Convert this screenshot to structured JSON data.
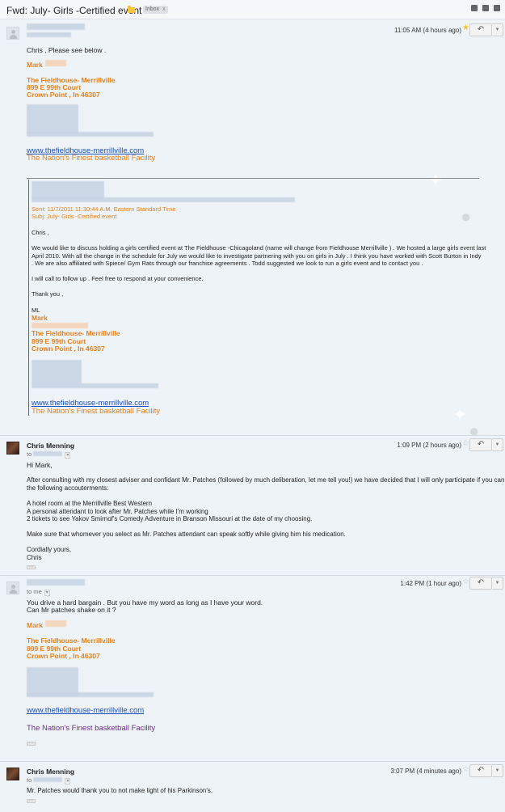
{
  "header": {
    "subject": "Fwd: July- Girls -Certified event",
    "label": "Inbox",
    "label_remove": "x",
    "icons": [
      "expand-icon",
      "print-icon",
      "popout-icon"
    ]
  },
  "messages": [
    {
      "sender": "",
      "time": "11:05 AM (4 hours ago)",
      "starred": true,
      "body": [
        "Chris , Please see below ."
      ],
      "signature": {
        "name": "Mark",
        "company": "The Fieldhouse- Merrillville",
        "address": "899 E 99th Court",
        "city": "Crown Point , In 46307",
        "link": "www.thefieldhouse-merrillville.com",
        "tagline": "The Nation's Finest basketball Facility"
      },
      "quoted": {
        "sent": "Sent: 11/7/2011 11:30:44 A.M. Eastern Standard Time",
        "subj": "Subj: July- Girls -Certified event",
        "greeting": "Chris ,",
        "p1": [
          "We would like to discuss holding a girls certified event at The Fieldhouse -Chicagoland (name will change from Fieldhouse Merrillville ) . We hosted a large girls event last",
          "April 2010. With all the change in the schedule for July we would like to investigate partnering with you on girls in July . I think you have worked with  Scott Burton in Indy",
          ". We are also affiliated with Spiece/ Gym Rats through our franchise agreements . Todd suggested we look to run a girls event and to contact you ."
        ],
        "p2": "I will call to follow up . Feel free to respond at your convenience.",
        "thanks": "Thank you ,",
        "initials": "ML",
        "name": "Mark",
        "company": "The Fieldhouse- Merrillville",
        "address": "899 E 99th Court",
        "city": "Crown Point , In 46307",
        "link": "www.thefieldhouse-merrillville.com",
        "tagline": "The Nation's Finest basketball Facility"
      }
    },
    {
      "sender": "Chris Menning",
      "to": "to",
      "time": "1:09 PM (2 hours ago)",
      "starred": false,
      "lines": [
        "Hi Mark,",
        "After consulting with my closest adviser and confidant Mr. Patches (followed by much deliberation, let me tell you!) we have decided that I will only participate if you can furnish",
        "the following accouterments:",
        "A hotel room at the Merrillville Best Western",
        "A personal attendant to look after Mr. Patches while I'm working",
        "2 tickets to see Yakov Smirnof's Comedy Adventure in Branson Missouri at the date of my choosing.",
        "Make sure that whomever you select as Mr. Patches attendant can speak softly while giving him his medication.",
        "Cordially yours,",
        "Chris"
      ]
    },
    {
      "sender": "",
      "to": "to me",
      "time": "1:42 PM (1 hour ago)",
      "starred": false,
      "lines": [
        "You drive a hard bargain . But you have my word as long as I have your word.",
        "Can Mr patches shake on it ?"
      ],
      "signature": {
        "name": "Mark",
        "company": "The Fieldhouse- Merrillville",
        "address": "899 E 99th Court",
        "city": "Crown Point , In 46307",
        "link": "www.thefieldhouse-merrillville.com",
        "tagline": "The Nation's Finest basketball Facility"
      }
    },
    {
      "sender": "Chris Menning",
      "to": "to",
      "time": "3:07 PM (4 minutes ago)",
      "starred": false,
      "lines": [
        "Mr. Patches would thank you to not make light of his Parkinson's."
      ]
    }
  ],
  "colors": {
    "signature": "#e8801a",
    "link": "#1a4fc4",
    "quote_bar": "#4a5ec8",
    "background": "#eef3f7",
    "tagline_visited": "#6b2b8a"
  }
}
